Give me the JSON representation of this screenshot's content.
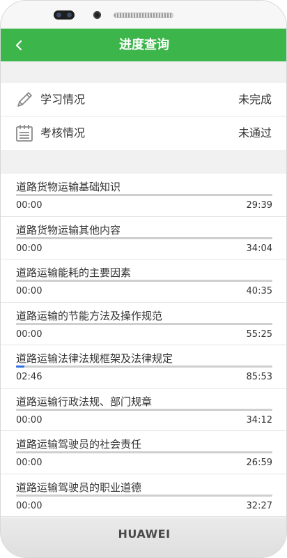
{
  "header": {
    "title": "进度查询",
    "back_icon": "chevron-left-icon",
    "color": "#3cb54a"
  },
  "status": [
    {
      "label": "学习情况",
      "value": "未完成",
      "icon": "pencil-icon"
    },
    {
      "label": "考核情况",
      "value": "未通过",
      "icon": "calendar-icon"
    }
  ],
  "courses": [
    {
      "title": "道路货物运输基础知识",
      "elapsed": "00:00",
      "duration": "29:39",
      "progress": 0
    },
    {
      "title": "道路货物运输其他内容",
      "elapsed": "00:00",
      "duration": "34:04",
      "progress": 0
    },
    {
      "title": "道路运输能耗的主要因素",
      "elapsed": "00:00",
      "duration": "40:35",
      "progress": 0
    },
    {
      "title": "道路运输的节能方法及操作规范",
      "elapsed": "00:00",
      "duration": "55:25",
      "progress": 0
    },
    {
      "title": "道路运输法律法规框架及法律规定",
      "elapsed": "02:46",
      "duration": "85:53",
      "progress": 0.032
    },
    {
      "title": "道路运输行政法规、部门规章",
      "elapsed": "00:00",
      "duration": "34:12",
      "progress": 0
    },
    {
      "title": "道路运输驾驶员的社会责任",
      "elapsed": "00:00",
      "duration": "26:59",
      "progress": 0
    },
    {
      "title": "道路运输驾驶员的职业道德",
      "elapsed": "00:00",
      "duration": "32:27",
      "progress": 0
    }
  ],
  "device": {
    "brand": "HUAWEI"
  }
}
